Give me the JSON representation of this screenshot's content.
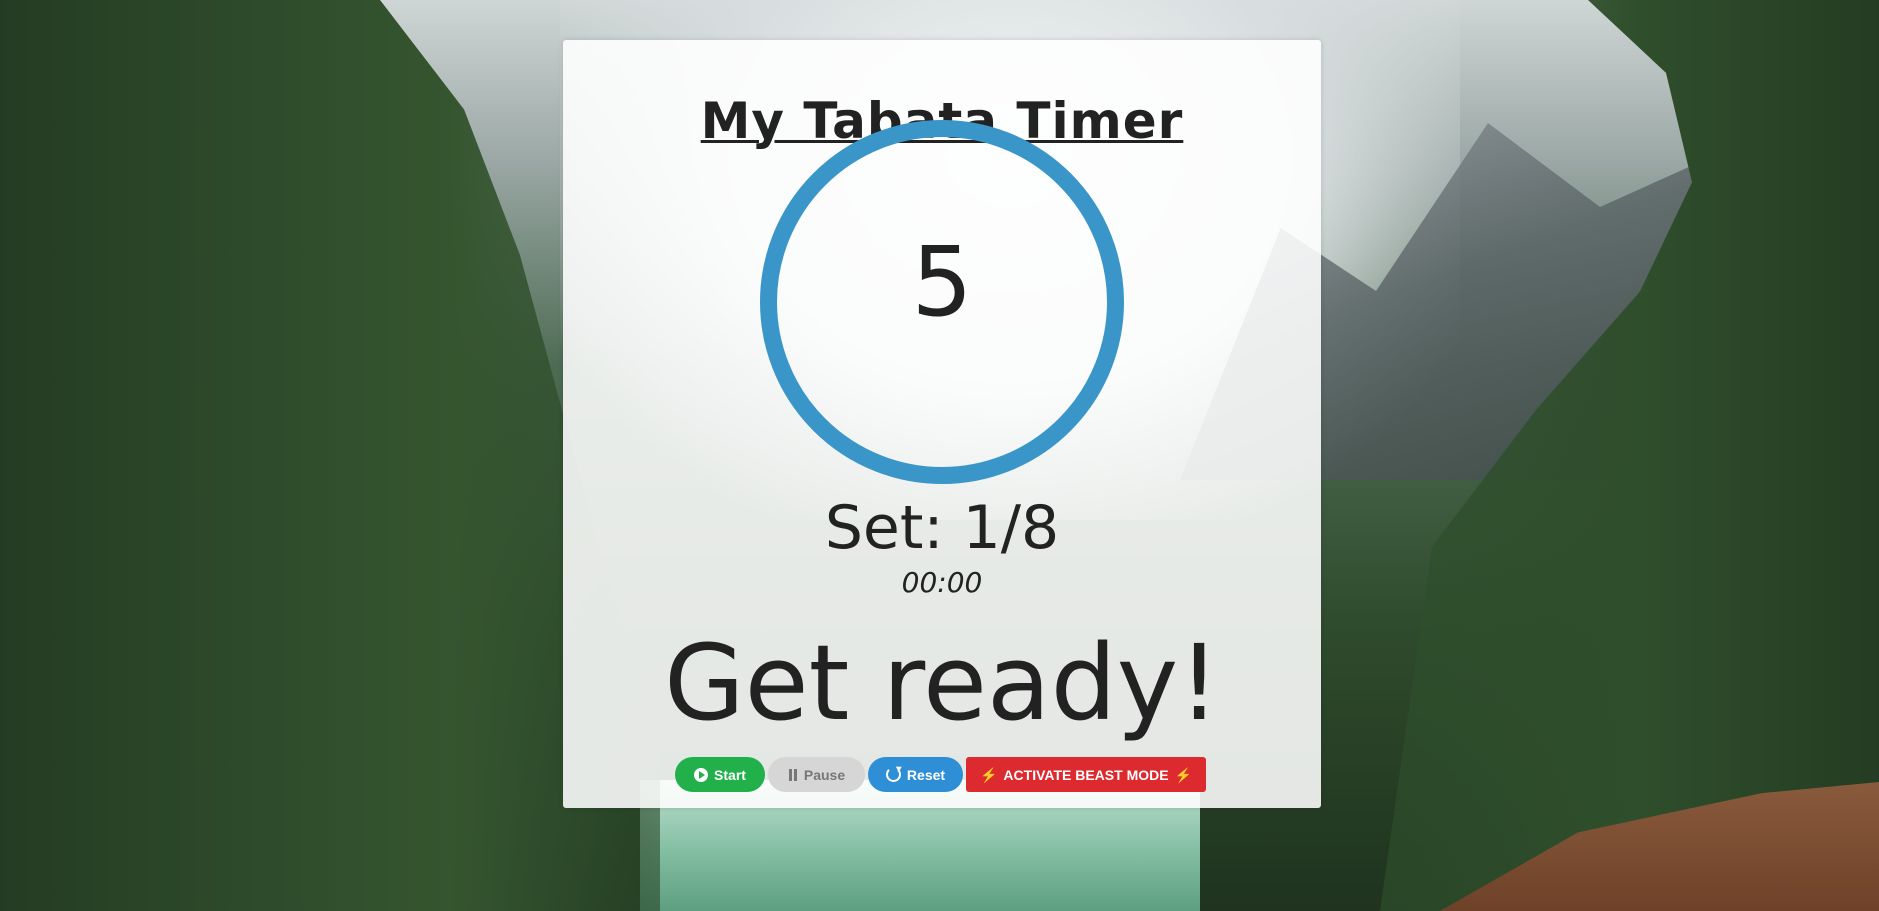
{
  "app": {
    "title": "My Tabata Timer"
  },
  "timer": {
    "countdown": "5",
    "set_label": "Set: 1/8",
    "elapsed": "00:00",
    "status": "Get ready!",
    "ring_color": "#3a96c8"
  },
  "controls": {
    "start_label": "Start",
    "pause_label": "Pause",
    "reset_label": "Reset",
    "beast_label": "ACTIVATE BEAST MODE",
    "start_icon": "play-circle-icon",
    "pause_icon": "pause-icon",
    "reset_icon": "refresh-icon",
    "beast_icon": "lightning-bolt-icon",
    "colors": {
      "start": "#22b04b",
      "pause": "#d6d6d6",
      "reset": "#2f8fd6",
      "beast": "#dc2a2f"
    }
  }
}
